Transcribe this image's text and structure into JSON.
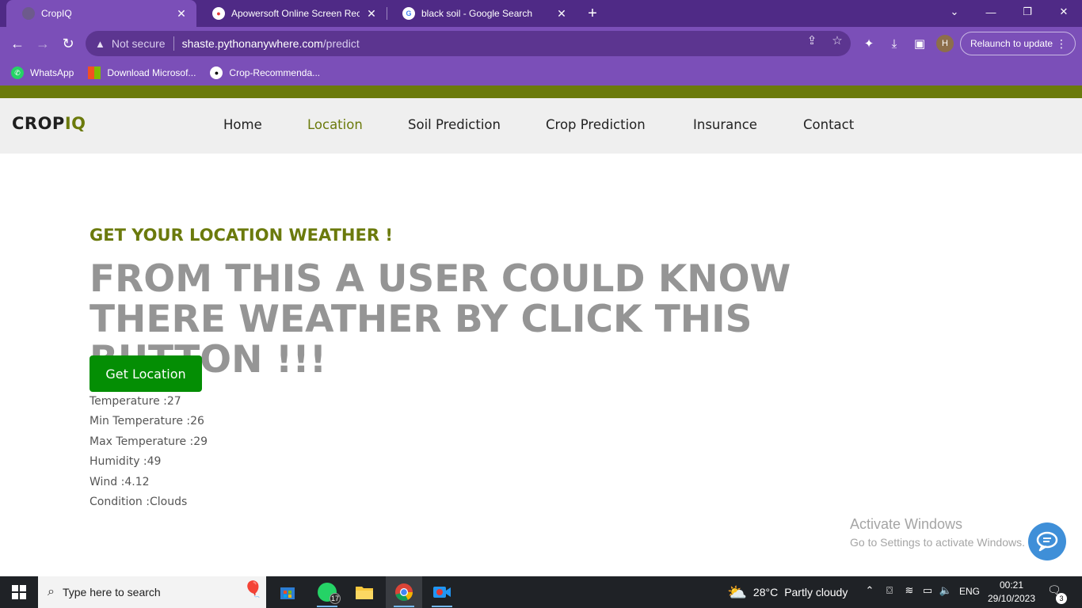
{
  "browser": {
    "tabs": [
      {
        "title": "CropIQ",
        "close": "✕"
      },
      {
        "title": "Apowersoft Online Screen Recor",
        "close": "✕"
      },
      {
        "title": "black soil - Google Search",
        "close": "✕"
      }
    ],
    "new_tab": "+",
    "address": {
      "warning_text": "Not secure",
      "host": "shaste.pythonanywhere.com",
      "path": "/predict"
    },
    "profile_initial": "H",
    "relaunch_label": "Relaunch to update",
    "bookmarks": [
      {
        "label": "WhatsApp"
      },
      {
        "label": "Download Microsof..."
      },
      {
        "label": "Crop-Recommenda..."
      }
    ]
  },
  "site": {
    "logo_part1": "CROP",
    "logo_part2": "IQ",
    "nav": [
      "Home",
      "Location",
      "Soil Prediction",
      "Crop Prediction",
      "Insurance",
      "Contact"
    ],
    "active_nav": "Location"
  },
  "hero": {
    "kicker": "GET YOUR LOCATION WEATHER !",
    "headline": "FROM THIS A USER COULD KNOW THERE WEATHER BY CLICK THIS BUTTON !!!",
    "button_label": "Get Location"
  },
  "weather": {
    "temperature": "Temperature :27",
    "min_temperature": "Min Temperature :26",
    "max_temperature": "Max Temperature :29",
    "humidity": "Humidity :49",
    "wind": "Wind :4.12",
    "condition": "Condition :Clouds"
  },
  "watermark": {
    "line1": "Activate Windows",
    "line2": "Go to Settings to activate Windows."
  },
  "taskbar": {
    "search_placeholder": "Type here to search",
    "whatsapp_badge": "17",
    "weather_temp": "28°C",
    "weather_desc": "Partly cloudy",
    "language": "ENG",
    "time": "00:21",
    "date": "29/10/2023",
    "notification_count": "3"
  },
  "colors": {
    "brand_olive": "#6b7a0c",
    "button_green": "#048e04",
    "headline_gray": "#959595",
    "chrome_purple": "#7b4fb8"
  }
}
